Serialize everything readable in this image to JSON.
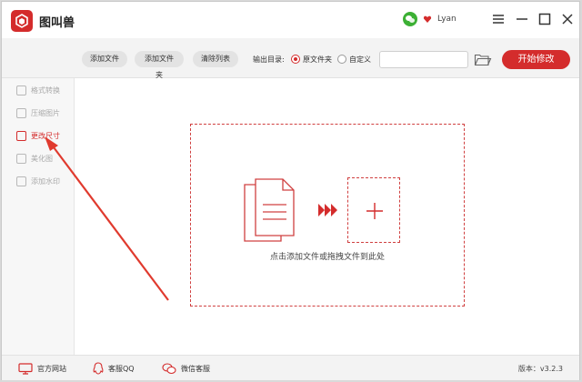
{
  "app": {
    "title": "图叫兽",
    "accent": "#d42c2c"
  },
  "user": {
    "name": "Lyan",
    "login_icon": "wechat-icon",
    "vip_icon": "vip-heart-icon"
  },
  "window_controls": [
    "menu-icon",
    "minimize-icon",
    "maximize-icon",
    "close-icon"
  ],
  "toolbar": {
    "add_file": "添加文件",
    "add_folder": "添加文件夹",
    "clear_list": "清除列表",
    "output_label": "输出目录:",
    "radio_original": "原文件夹",
    "radio_custom": "自定义",
    "selected_output": "原文件夹",
    "path_value": "",
    "path_placeholder": "",
    "start": "开始修改"
  },
  "sidebar": {
    "items": [
      {
        "label": "格式转换",
        "icon": "format-convert-icon",
        "active": false
      },
      {
        "label": "压缩图片",
        "icon": "compress-icon",
        "active": false
      },
      {
        "label": "更改尺寸",
        "icon": "resize-icon",
        "active": true
      },
      {
        "label": "美化图",
        "icon": "beautify-icon",
        "active": false
      },
      {
        "label": "添加水印",
        "icon": "watermark-icon",
        "active": false
      }
    ]
  },
  "main": {
    "drop_hint": "点击添加文件或拖拽文件到此处"
  },
  "statusbar": {
    "website": "官方网站",
    "qq_service": "客服QQ",
    "wechat_service": "微信客服",
    "version": "版本：v3.2.3"
  }
}
